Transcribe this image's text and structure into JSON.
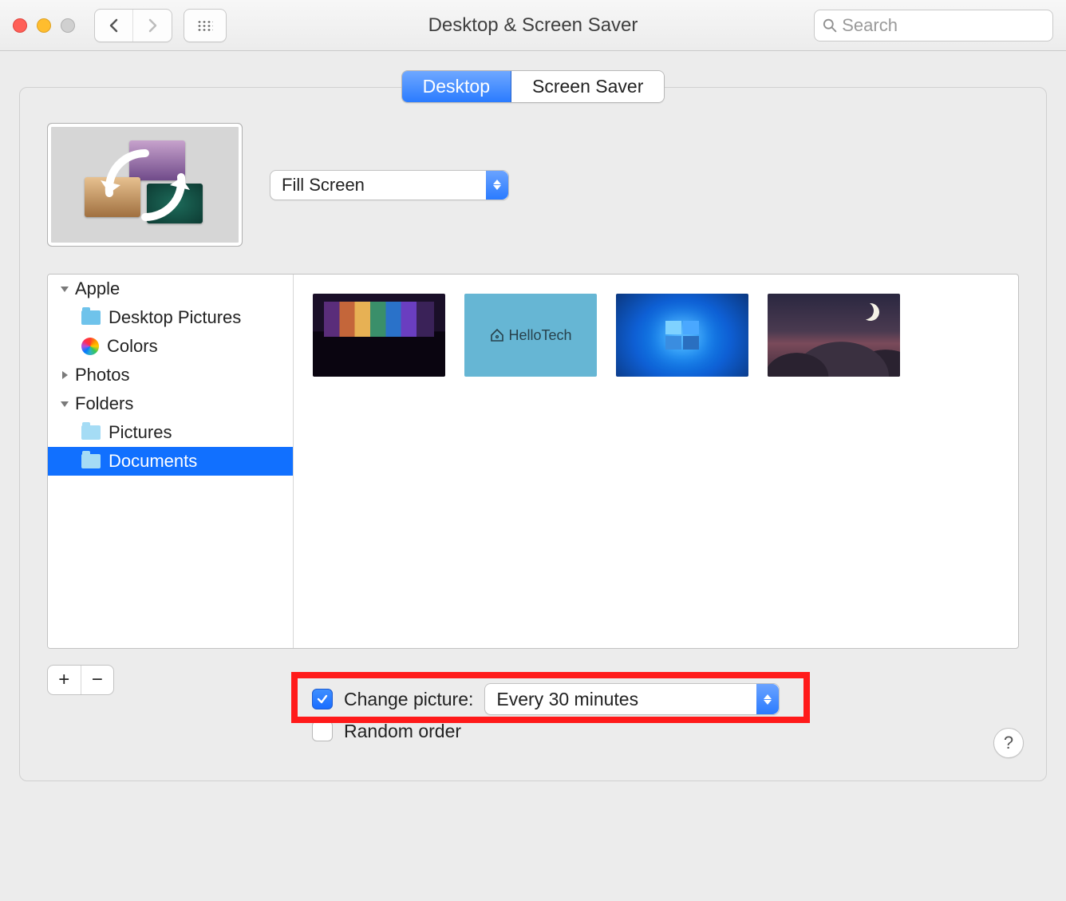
{
  "window": {
    "title": "Desktop & Screen Saver"
  },
  "search": {
    "placeholder": "Search"
  },
  "tabs": {
    "desktop": "Desktop",
    "screensaver": "Screen Saver",
    "active": "desktop"
  },
  "fillMode": {
    "selected": "Fill Screen"
  },
  "sidebar": {
    "apple": {
      "label": "Apple",
      "expanded": true,
      "items": {
        "desktop_pictures": "Desktop Pictures",
        "colors": "Colors"
      }
    },
    "photos": {
      "label": "Photos",
      "expanded": false
    },
    "folders": {
      "label": "Folders",
      "expanded": true,
      "items": {
        "pictures": "Pictures",
        "documents": "Documents"
      },
      "selected": "documents"
    }
  },
  "thumbnails": {
    "hellotech_label": "HelloTech"
  },
  "controls": {
    "add": "+",
    "remove": "−"
  },
  "options": {
    "change_picture": {
      "label": "Change picture:",
      "checked": true,
      "interval": "Every 30 minutes"
    },
    "random_order": {
      "label": "Random order",
      "checked": false
    }
  },
  "help": "?"
}
